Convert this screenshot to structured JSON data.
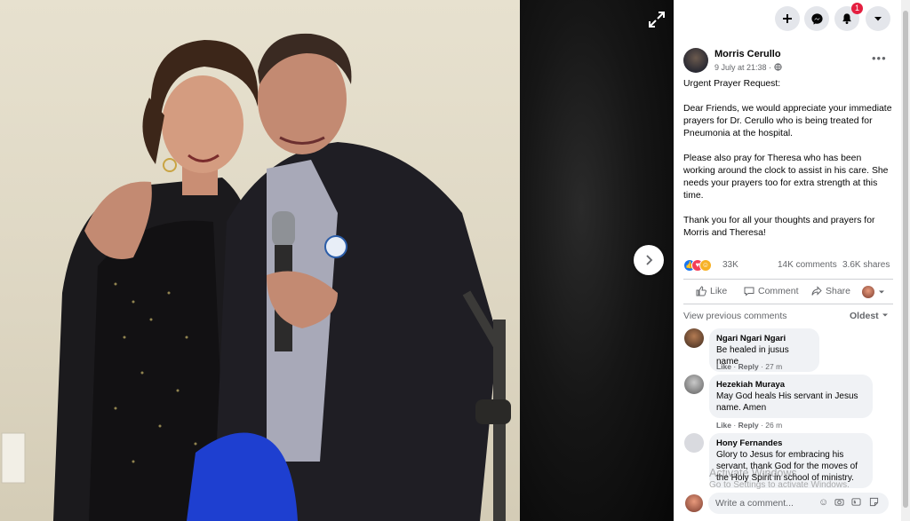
{
  "topbar": {
    "plus_icon": "plus-icon",
    "messenger_icon": "messenger-icon",
    "notifications_badge": "1",
    "dropdown_icon": "caret-down-icon"
  },
  "post": {
    "author": "Morris Cerullo",
    "timestamp": "9 July at 21:38 ·",
    "body": "Urgent Prayer Request:\n\nDear Friends, we would appreciate your immediate prayers for Dr. Cerullo who is being treated for Pneumonia at the hospital.\n\nPlease also pray for Theresa who has been working around the clock to assist in his care. She needs your prayers too for extra strength at this time.\n\nThank you for all your thoughts and prayers for Morris and Theresa!",
    "reactions_count": "33K",
    "comments_count": "14K comments",
    "shares_count": "3.6K shares"
  },
  "actions": {
    "like": "Like",
    "comment": "Comment",
    "share": "Share"
  },
  "comments_section": {
    "view_previous": "View previous comments",
    "sort": "Oldest"
  },
  "comments": [
    {
      "name": "Ngari Ngari Ngari",
      "text": "Be healed in jusus name",
      "like": "Like",
      "reply": "Reply",
      "time": "27 m"
    },
    {
      "name": "Hezekiah Muraya",
      "text": "May God heals His servant in Jesus name. Amen",
      "like": "Like",
      "reply": "Reply",
      "time": "26 m"
    },
    {
      "name": "Hony Fernandes",
      "text": "Glory to Jesus for embracing his servant, thank God for the moves of the Holy Spirit in school of ministry."
    }
  ],
  "composer": {
    "placeholder": "Write a comment..."
  },
  "watermark": {
    "line1": "Activate Windows",
    "line2": "Go to Settings to activate Windows."
  },
  "colors": {
    "accent": "#1877f2",
    "notification_red": "#e41e3f",
    "muted_text": "#65676b"
  }
}
